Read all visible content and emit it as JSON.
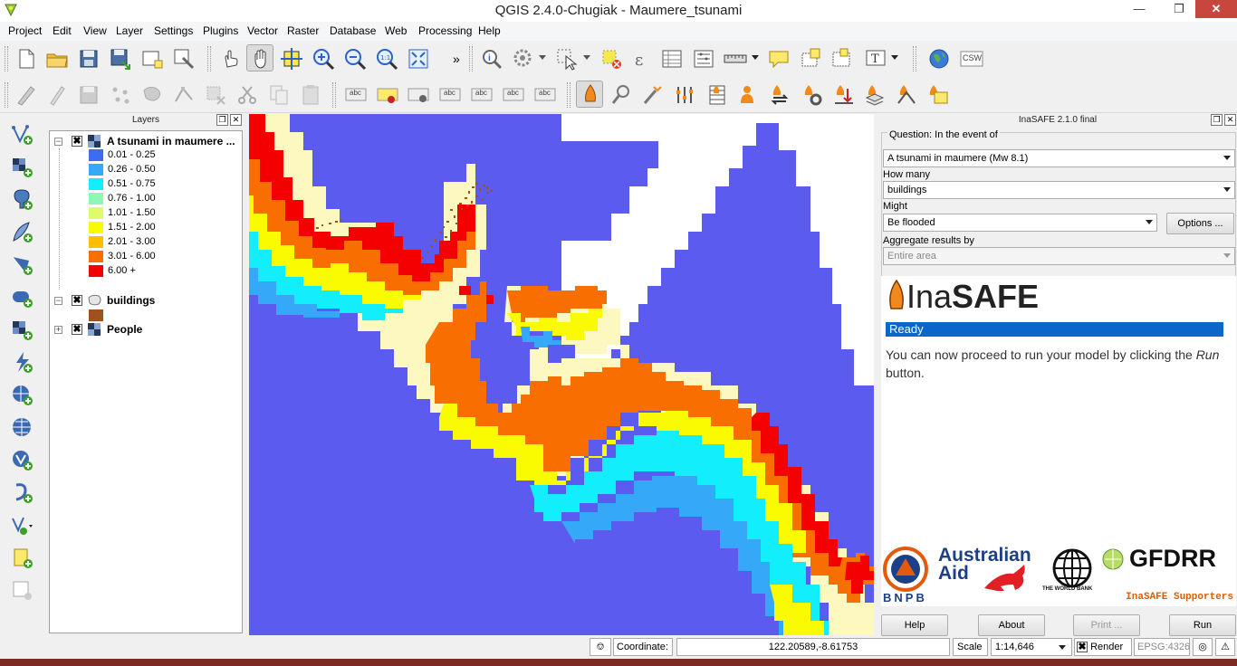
{
  "window": {
    "title": "QGIS 2.4.0-Chugiak - Maumere_tsunami"
  },
  "menu": [
    "Project",
    "Edit",
    "View",
    "Layer",
    "Settings",
    "Plugins",
    "Vector",
    "Raster",
    "Database",
    "Web",
    "Processing",
    "Help"
  ],
  "toolbar_overflow": "»",
  "toolbar_csw": "CSW",
  "toolbar_labels": [
    "abc",
    "abc",
    "abc",
    "abc",
    "abc",
    "abc",
    "abc"
  ],
  "layers_panel": {
    "title": "Layers",
    "layers": [
      {
        "name": "A tsunami in maumere ...",
        "checked": "✖",
        "expanded": "−"
      },
      {
        "name": "buildings",
        "checked": "✖",
        "expanded": "−"
      },
      {
        "name": "People",
        "checked": "✖",
        "expanded": "+"
      }
    ],
    "legend": [
      {
        "label": "0.01 - 0.25",
        "color": "#3b6cf2"
      },
      {
        "label": "0.26 - 0.50",
        "color": "#35a8f7"
      },
      {
        "label": "0.51 - 0.75",
        "color": "#13eefc"
      },
      {
        "label": "0.76 - 1.00",
        "color": "#8ef7b3"
      },
      {
        "label": "1.01 - 1.50",
        "color": "#dffa6a"
      },
      {
        "label": "1.51 - 2.00",
        "color": "#fbfb00"
      },
      {
        "label": "2.01 - 3.00",
        "color": "#fbbf00"
      },
      {
        "label": "3.01 - 6.00",
        "color": "#f86f00"
      },
      {
        "label": "6.00 +",
        "color": "#f50000"
      }
    ],
    "buildings_color": "#a0521d"
  },
  "inasafe": {
    "title": "InaSAFE 2.1.0 final",
    "question_label": "Question: In the event of",
    "hazard": "A tsunami in maumere (Mw 8.1)",
    "how_many_label": "How many",
    "exposure": "buildings",
    "might_label": "Might",
    "impact": "Be flooded",
    "options_button": "Options ...",
    "aggregate_label": "Aggregate results by",
    "aggregate": "Entire area",
    "logo_light": "Ina",
    "logo_bold": "SAFE",
    "status": "Ready",
    "message_before": "You can now proceed to run your model by clicking the ",
    "message_run": "Run",
    "message_after": " button.",
    "supporters": {
      "bnpb": "BNPB",
      "australian": "Australian",
      "aid": "Aid",
      "worldbank": "THE WORLD BANK",
      "gfdrr": "GFDRR",
      "caption": "InaSAFE Supporters"
    },
    "buttons": {
      "help": "Help",
      "about": "About",
      "print": "Print ...",
      "run": "Run"
    }
  },
  "statusbar": {
    "coordinate_label": "Coordinate:",
    "coordinate": "122.20589,-8.61753",
    "scale_label": "Scale",
    "scale": "1:14,646",
    "render_label": "Render",
    "render_checked": "✖",
    "crs": "EPSG:4326"
  },
  "colors": {
    "sea": "#5b5bef",
    "land": "#ffffff",
    "coast": "#fdf7c0",
    "accent_blue": "#0a66c8",
    "supporters_caption": "#e05a00"
  }
}
